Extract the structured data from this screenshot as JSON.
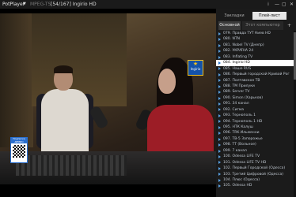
{
  "titlebar": {
    "app_name": "PotPlayer",
    "menu_caret": "▼",
    "file_name": "MPEG-TS",
    "track_info": "[54/167] Ingirio HD",
    "controls": [
      "⁞",
      "—",
      "▢",
      "✕"
    ]
  },
  "video": {
    "channel_logo_text": "Ingirio",
    "qr_label": "Подписка ДРМИО"
  },
  "panel": {
    "tabs": [
      "Закладки",
      "Плей-лист"
    ],
    "subtabs": {
      "main": "Основной",
      "other": "Этот компьютер",
      "add": "+"
    },
    "items": [
      {
        "label": "079. Правда ТУТ Киев HD",
        "active": false
      },
      {
        "label": "080. NTN",
        "active": false
      },
      {
        "label": "081. Nobel TV (Днепр)",
        "active": false
      },
      {
        "label": "082. УКРАЇНА 24",
        "active": false
      },
      {
        "label": "083. Inflating TV",
        "active": false
      },
      {
        "label": "084. Ingirio HD",
        "active": true
      },
      {
        "label": "085. Наше RUS",
        "active": false
      },
      {
        "label": "086. Первый городской Кривой Рог",
        "active": false
      },
      {
        "label": "087. Полтавское ТВ",
        "active": false
      },
      {
        "label": "088. ТМ Прилуки",
        "active": false
      },
      {
        "label": "089. Server TV",
        "active": false
      },
      {
        "label": "090. Simon (Харьков)",
        "active": false
      },
      {
        "label": "091. 34 канал",
        "active": false
      },
      {
        "label": "092. Сигма",
        "active": false
      },
      {
        "label": "093. Тернополь 1",
        "active": false
      },
      {
        "label": "094. Тернополь 1 HD",
        "active": false
      },
      {
        "label": "095. НТК Калуш",
        "active": false
      },
      {
        "label": "096. TRK Ильменни",
        "active": false
      },
      {
        "label": "097. ТВ-5 Запорожье",
        "active": false
      },
      {
        "label": "098. ТТ (Вольное)",
        "active": false
      },
      {
        "label": "099. 7 канал",
        "active": false
      },
      {
        "label": "100. Odessa LIFE TV",
        "active": false
      },
      {
        "label": "101. Odessa LIFE TV HD",
        "active": false
      },
      {
        "label": "102. Первый Городской (Одесса)",
        "active": false
      },
      {
        "label": "103. Третий Цифровой (Одесса)",
        "active": false
      },
      {
        "label": "104. Плюс (Одесса)",
        "active": false
      },
      {
        "label": "105. Odessa HD",
        "active": false
      }
    ]
  }
}
